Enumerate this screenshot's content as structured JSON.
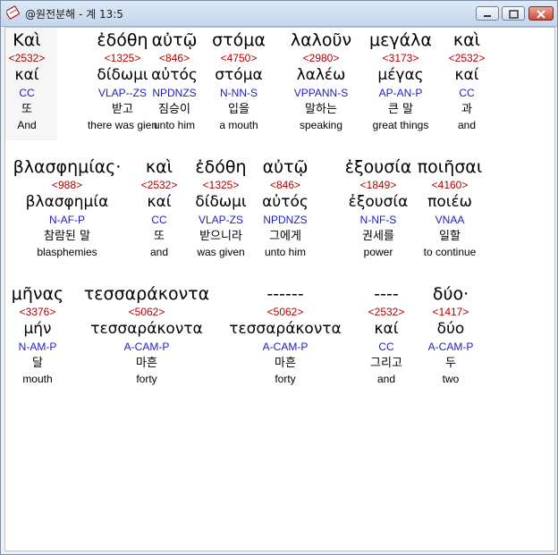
{
  "window": {
    "title": "@원전분해 - 계 13:5"
  },
  "rows": [
    [
      {
        "greek": "Καὶ",
        "strong": "<2532>",
        "lemma": "καί",
        "parse": "CC",
        "korean": "또",
        "english": "And"
      },
      {
        "greek": "ἐδόθη",
        "strong": "<1325>",
        "lemma": "δίδωμι",
        "parse": "VLAP--ZS",
        "korean": "받고",
        "english": "there was gien"
      },
      {
        "greek": "αὐτῷ",
        "strong": "<846>",
        "lemma": "αὐτός",
        "parse": "NPDNZS",
        "korean": "짐승이",
        "english": "unto him"
      },
      {
        "greek": "στόμα",
        "strong": "<4750>",
        "lemma": "στόμα",
        "parse": "N-NN-S",
        "korean": "입을",
        "english": "a mouth"
      },
      {
        "greek": "λαλοῦν",
        "strong": "<2980>",
        "lemma": "λαλέω",
        "parse": "VPPANN-S",
        "korean": "말하는",
        "english": "speaking"
      },
      {
        "greek": "μεγάλα",
        "strong": "<3173>",
        "lemma": "μέγας",
        "parse": "AP-AN-P",
        "korean": "큰 말",
        "english": "great things"
      },
      {
        "greek": "καὶ",
        "strong": "<2532>",
        "lemma": "καί",
        "parse": "CC",
        "korean": "과",
        "english": "and"
      }
    ],
    [
      {
        "greek": "βλασφημίας·",
        "strong": "<988>",
        "lemma": "βλασφημία",
        "parse": "N-AF-P",
        "korean": "참람된 말",
        "english": "blasphemies"
      },
      {
        "greek": "καὶ",
        "strong": "<2532>",
        "lemma": "καί",
        "parse": "CC",
        "korean": "또",
        "english": "and"
      },
      {
        "greek": "ἐδόθη",
        "strong": "<1325>",
        "lemma": "δίδωμι",
        "parse": "VLAP-ZS",
        "korean": "받으니라",
        "english": "was given"
      },
      {
        "greek": "αὐτῷ",
        "strong": "<846>",
        "lemma": "αὐτός",
        "parse": "NPDNZS",
        "korean": "그에게",
        "english": "unto him"
      },
      {
        "greek": "ἐξουσία",
        "strong": "<1849>",
        "lemma": "ἐξουσία",
        "parse": "N-NF-S",
        "korean": "권세를",
        "english": "power"
      },
      {
        "greek": "ποιῆσαι",
        "strong": "<4160>",
        "lemma": "ποιέω",
        "parse": "VNAA",
        "korean": "일할",
        "english": "to continue"
      }
    ],
    [
      {
        "greek": "μῆνας",
        "strong": "<3376>",
        "lemma": "μήν",
        "parse": "N-AM-P",
        "korean": "달",
        "english": "mouth"
      },
      {
        "greek": "τεσσαράκοντα",
        "strong": "<5062>",
        "lemma": "τεσσαράκοντα",
        "parse": "A-CAM-P",
        "korean": "마흔",
        "english": "forty"
      },
      {
        "greek": "------",
        "strong": "<5062>",
        "lemma": "τεσσαράκοντα",
        "parse": "A-CAM-P",
        "korean": "마흔",
        "english": "forty"
      },
      {
        "greek": "----",
        "strong": "<2532>",
        "lemma": "καί",
        "parse": "CC",
        "korean": "그리고",
        "english": "and"
      },
      {
        "greek": "δύο·",
        "strong": "<1417>",
        "lemma": "δύο",
        "parse": "A-CAM-P",
        "korean": "두",
        "english": "two"
      }
    ]
  ]
}
